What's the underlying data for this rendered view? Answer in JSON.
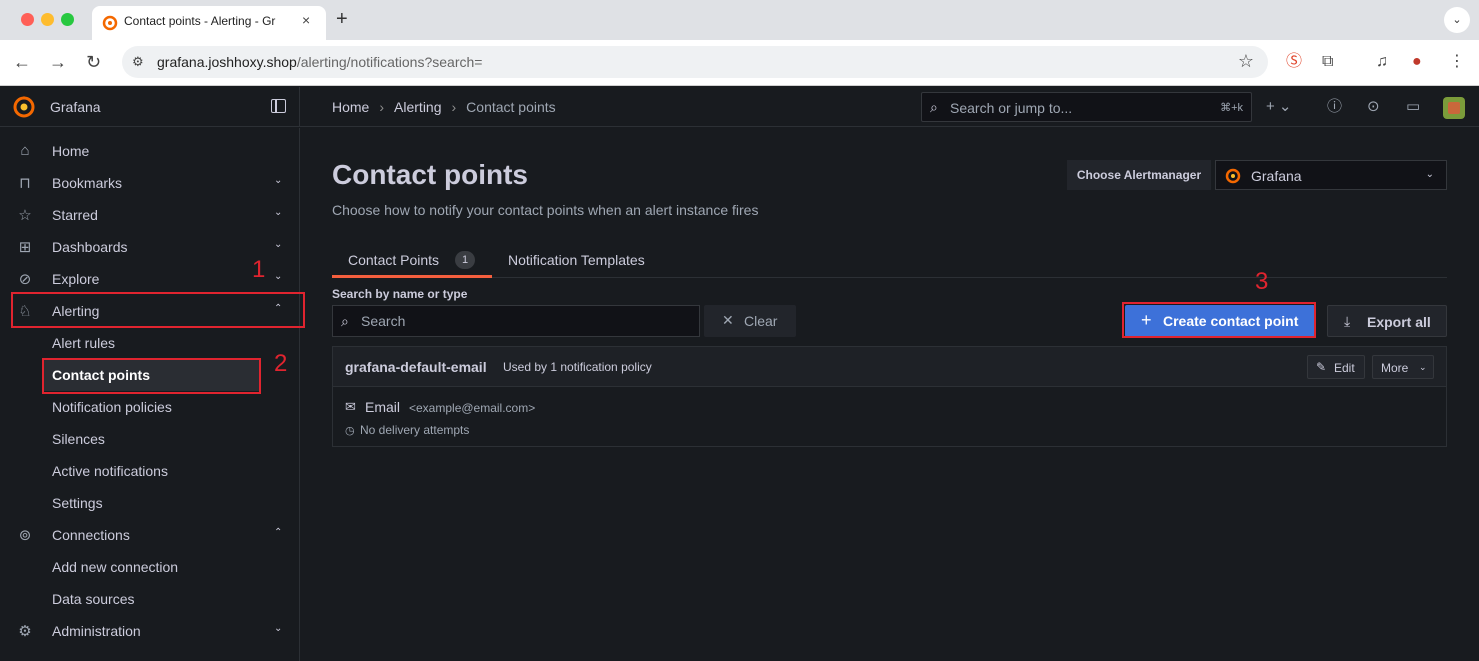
{
  "browser": {
    "tab_title": "Contact points - Alerting - Gr",
    "tab_close": "×",
    "new_tab": "+",
    "url_host": "grafana.joshhoxy.shop",
    "url_path": "/alerting/notifications?search="
  },
  "topbar": {
    "brand": "Grafana",
    "breadcrumbs": [
      "Home",
      "Alerting",
      "Contact points"
    ],
    "breadcrumb_sep": "›",
    "search_placeholder": "Search or jump to...",
    "search_shortcut": "⌘+k"
  },
  "sidebar": {
    "items": [
      {
        "label": "Home",
        "icon": "home-icon"
      },
      {
        "label": "Bookmarks",
        "icon": "bookmark-icon"
      },
      {
        "label": "Starred",
        "icon": "star-icon"
      },
      {
        "label": "Dashboards",
        "icon": "dashboards-icon"
      },
      {
        "label": "Explore",
        "icon": "compass-icon"
      },
      {
        "label": "Alerting",
        "icon": "bell-icon"
      },
      {
        "label": "Connections",
        "icon": "connections-icon"
      },
      {
        "label": "Administration",
        "icon": "gear-icon"
      }
    ],
    "alerting_sub": [
      "Alert rules",
      "Contact points",
      "Notification policies",
      "Silences",
      "Active notifications",
      "Settings"
    ],
    "connections_sub": [
      "Add new connection",
      "Data sources"
    ]
  },
  "annotations": [
    "1",
    "2",
    "3"
  ],
  "page": {
    "title": "Contact points",
    "subtitle": "Choose how to notify your contact points when an alert instance fires",
    "alertmanager_label": "Choose Alertmanager",
    "alertmanager_value": "Grafana",
    "tabs": [
      {
        "label": "Contact Points",
        "count": "1"
      },
      {
        "label": "Notification Templates"
      }
    ],
    "search_label": "Search by name or type",
    "search_placeholder": "Search",
    "clear_label": "Clear",
    "create_label": "Create contact point",
    "export_label": "Export all"
  },
  "contact_point": {
    "name": "grafana-default-email",
    "used_by": "Used by 1 notification policy",
    "edit_label": "Edit",
    "more_label": "More",
    "integration_type": "Email",
    "integration_address": "<example@email.com>",
    "delivery_status": "No delivery attempts"
  },
  "colors": {
    "accent": "#3d71d9",
    "tab_underline": "#f55f3e",
    "annotation": "#e0242f"
  }
}
